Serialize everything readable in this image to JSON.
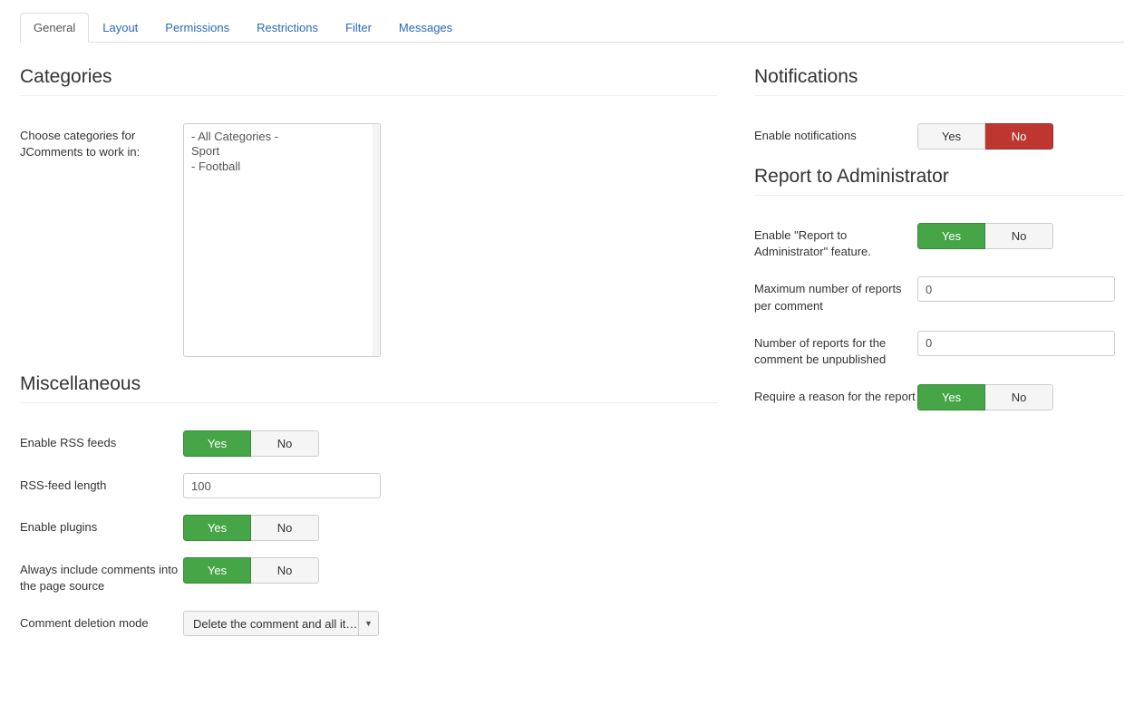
{
  "tabs": [
    "General",
    "Layout",
    "Permissions",
    "Restrictions",
    "Filter",
    "Messages"
  ],
  "activeTab": 0,
  "yes": "Yes",
  "no": "No",
  "left": {
    "categories": {
      "heading": "Categories",
      "label": "Choose categories for JComments to work in:",
      "options": [
        "- All Categories -",
        "Sport",
        "- Football"
      ]
    },
    "misc": {
      "heading": "Miscellaneous",
      "rss": {
        "label": "Enable RSS feeds",
        "value": "yes"
      },
      "rssLen": {
        "label": "RSS-feed length",
        "value": "100"
      },
      "plugins": {
        "label": "Enable plugins",
        "value": "yes"
      },
      "includeSrc": {
        "label": "Always include comments into the page source",
        "value": "yes"
      },
      "deletion": {
        "label": "Comment deletion mode",
        "selected": "Delete the comment and all it…"
      }
    }
  },
  "right": {
    "notifications": {
      "heading": "Notifications",
      "enable": {
        "label": "Enable notifications",
        "value": "no"
      }
    },
    "report": {
      "heading": "Report to Administrator",
      "enable": {
        "label": "Enable \"Report to Administrator\" feature.",
        "value": "yes"
      },
      "maxReports": {
        "label": "Maximum number of reports per comment",
        "value": "0"
      },
      "unpublishAt": {
        "label": "Number of reports for the comment be unpublished",
        "value": "0"
      },
      "requireReason": {
        "label": "Require a reason for the report",
        "value": "yes"
      }
    }
  }
}
